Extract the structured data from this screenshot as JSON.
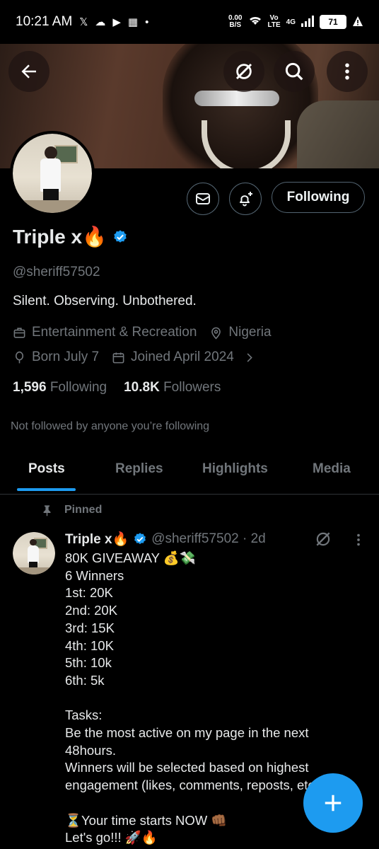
{
  "status_bar": {
    "time": "10:21 AM",
    "net_speed_value": "0.00",
    "net_speed_unit": "B/S",
    "volte_top": "Vo",
    "volte_bottom": "LTE",
    "network": "4G",
    "battery": "71",
    "icons": [
      "x-logo-icon",
      "cloud-icon",
      "youtube-icon",
      "news-icon",
      "dot-icon",
      "wifi-icon",
      "signal-icon",
      "battery-icon",
      "alert-icon"
    ]
  },
  "header": {
    "icons": [
      "back-arrow-icon",
      "grok-icon",
      "search-icon",
      "more-vertical-icon"
    ]
  },
  "profile": {
    "display_name": "Triple x🔥",
    "handle": "@sheriff57502",
    "bio": "Silent. Observing. Unbothered.",
    "category": "Entertainment & Recreation",
    "location": "Nigeria",
    "birthday": "Born July 7",
    "joined": "Joined April 2024",
    "following_count": "1,596",
    "following_label": "Following",
    "followers_count": "10.8K",
    "followers_label": "Followers",
    "not_followed_text": "Not followed by anyone you’re following",
    "follow_button_label": "Following",
    "accent_color": "#1d9bf0"
  },
  "tabs": [
    {
      "label": "Posts"
    },
    {
      "label": "Replies"
    },
    {
      "label": "Highlights"
    },
    {
      "label": "Media"
    }
  ],
  "pinned_tweet": {
    "pinned_label": "Pinned",
    "name": "Triple x🔥",
    "handle_time": "@sheriff57502 · 2d",
    "text": "80K GIVEAWAY 💰💸\n6 Winners\n1st: 20K\n2nd: 20K\n3rd: 15K\n4th: 10K\n5th: 10k\n6th: 5k\n\nTasks:\nBe the most active on my page in the next 48hours.\nWinners will be selected based on highest engagement (likes, comments, reposts, etc).\n\n⏳Your time starts NOW 👊🏾\nLet's go!!! 🚀🔥"
  }
}
